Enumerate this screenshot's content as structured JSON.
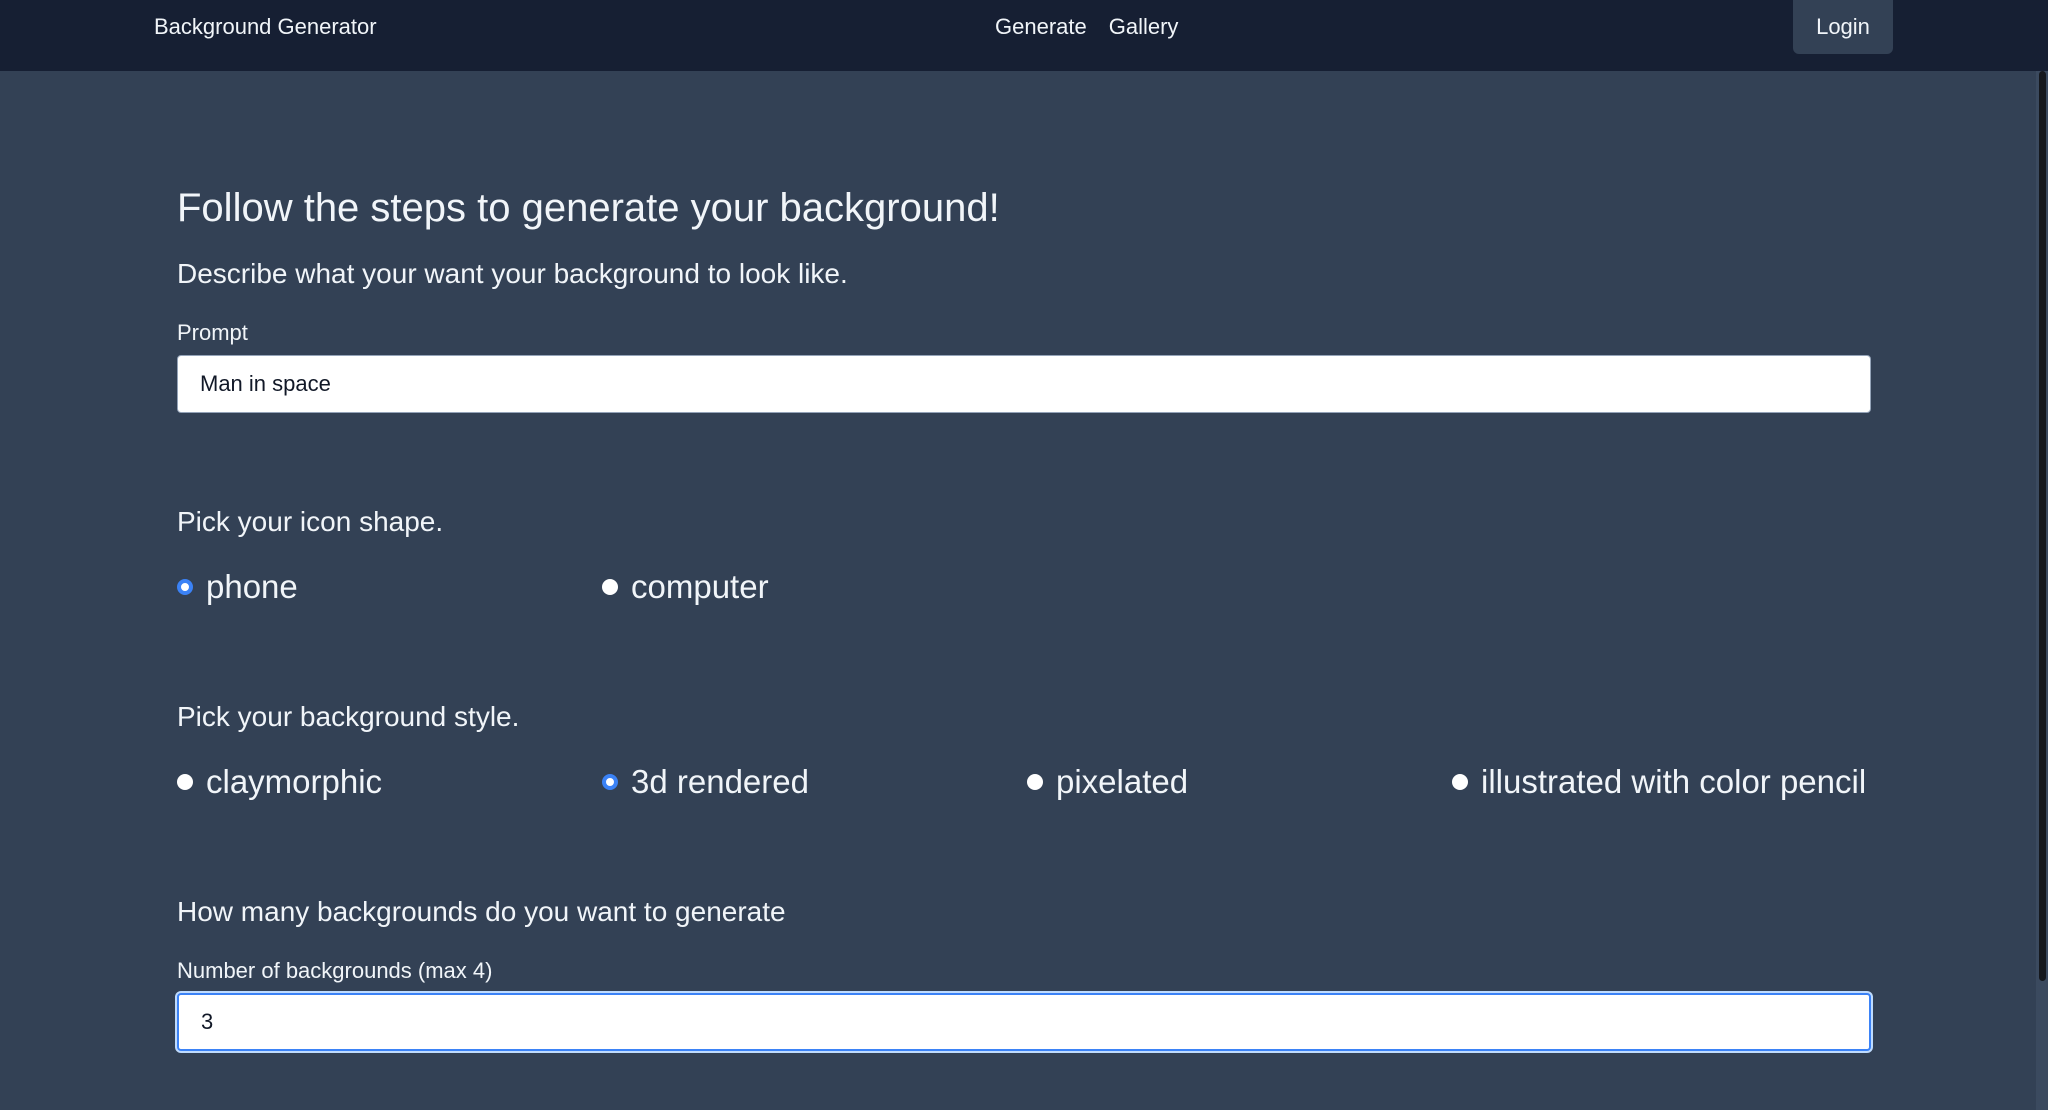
{
  "navbar": {
    "brand": "Background Generator",
    "links": [
      "Generate",
      "Gallery"
    ],
    "login_label": "Login"
  },
  "main": {
    "title": "Follow the steps to generate your background!",
    "prompt_step": {
      "heading": "Describe what your want your background to look like.",
      "label": "Prompt",
      "value": "Man in space"
    },
    "shape_step": {
      "heading": "Pick your icon shape.",
      "options": [
        "phone",
        "computer"
      ],
      "selected": "phone"
    },
    "style_step": {
      "heading": "Pick your background style.",
      "options": [
        "claymorphic",
        "3d rendered",
        "pixelated",
        "illustrated with color pencil"
      ],
      "selected": "3d rendered"
    },
    "count_step": {
      "heading": "How many backgrounds do you want to generate",
      "label": "Number of backgrounds (max 4)",
      "value": "3"
    }
  },
  "colors": {
    "page_bg": "#334155",
    "navbar_bg": "#161f33",
    "accent": "#3b82f6",
    "text": "#f1f5f9"
  }
}
